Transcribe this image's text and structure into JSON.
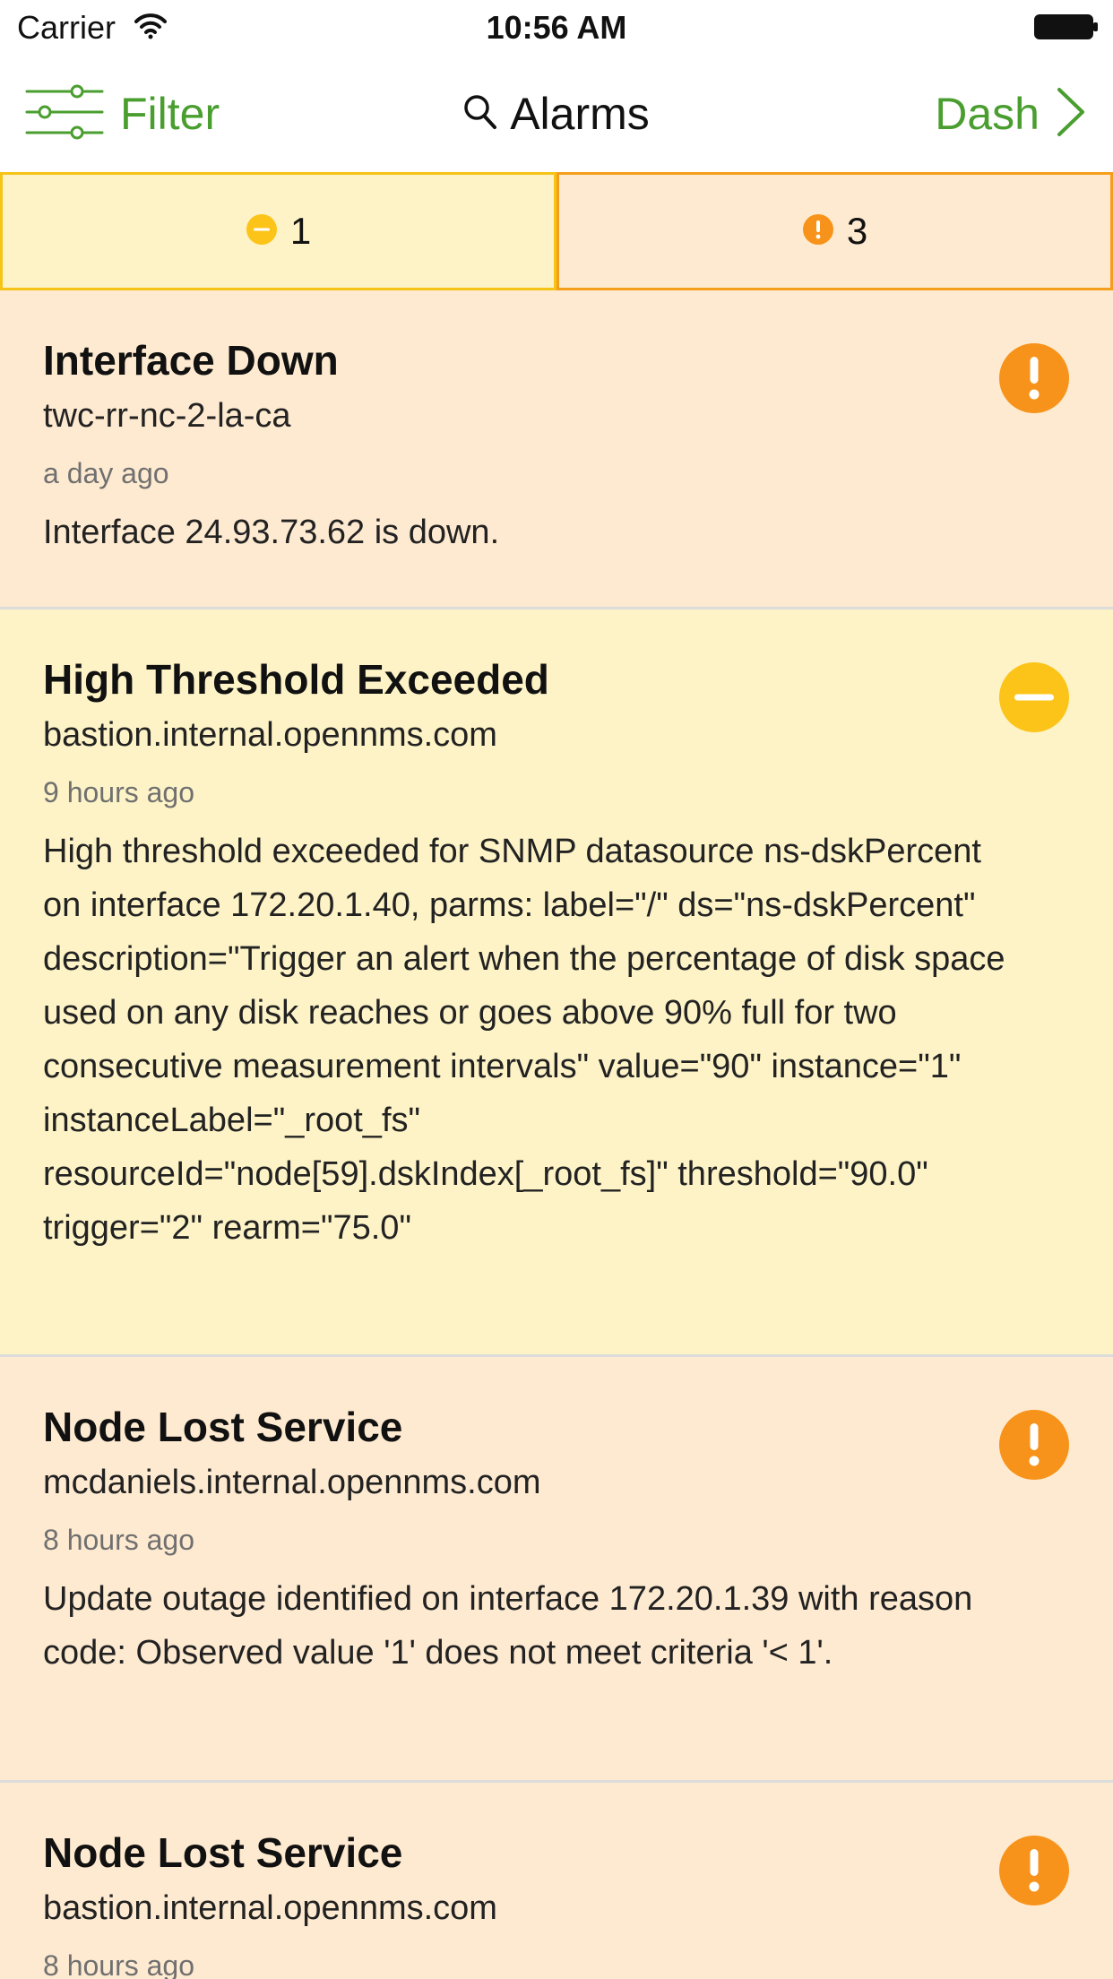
{
  "status_bar": {
    "carrier": "Carrier",
    "time": "10:56 AM"
  },
  "nav": {
    "filter_label": "Filter",
    "title": "Alarms",
    "dash_label": "Dash"
  },
  "tabs": [
    {
      "severity": "minor",
      "icon": "minus-circle-icon",
      "count": "1",
      "color": "#f6c417"
    },
    {
      "severity": "major",
      "icon": "exclamation-circle-icon",
      "count": "3",
      "color": "#f59e1c"
    }
  ],
  "colors": {
    "accent": "#4a9e2f",
    "major_bg": "#feead0",
    "minor_bg": "#fdf3c6",
    "major_icon": "#f7931a",
    "minor_icon": "#fcc419"
  },
  "alarms": [
    {
      "severity": "major",
      "icon": "exclamation-circle-icon",
      "title": "Interface Down",
      "host": "twc-rr-nc-2-la-ca",
      "time": "a day ago",
      "description": "Interface 24.93.73.62 is down."
    },
    {
      "severity": "minor",
      "icon": "minus-circle-icon",
      "title": "High Threshold Exceeded",
      "host": "bastion.internal.opennms.com",
      "time": "9 hours ago",
      "description": "High threshold exceeded for SNMP datasource ns-dskPercent on interface 172.20.1.40, parms: label=\"/\" ds=\"ns-dskPercent\" description=\"Trigger an alert when the percentage of disk space used on any disk reaches or goes above 90% full for two consecutive measurement intervals\" value=\"90\" instance=\"1\" instanceLabel=\"_root_fs\" resourceId=\"node[59].dskIndex[_root_fs]\" threshold=\"90.0\" trigger=\"2\" rearm=\"75.0\""
    },
    {
      "severity": "major",
      "icon": "exclamation-circle-icon",
      "title": "Node Lost Service",
      "host": "mcdaniels.internal.opennms.com",
      "time": "8 hours ago",
      "description": "Update outage identified on interface 172.20.1.39 with reason code: Observed value '1' does not meet criteria '< 1'."
    },
    {
      "severity": "major",
      "icon": "exclamation-circle-icon",
      "title": "Node Lost Service",
      "host": "bastion.internal.opennms.com",
      "time": "8 hours ago",
      "description": ""
    }
  ]
}
